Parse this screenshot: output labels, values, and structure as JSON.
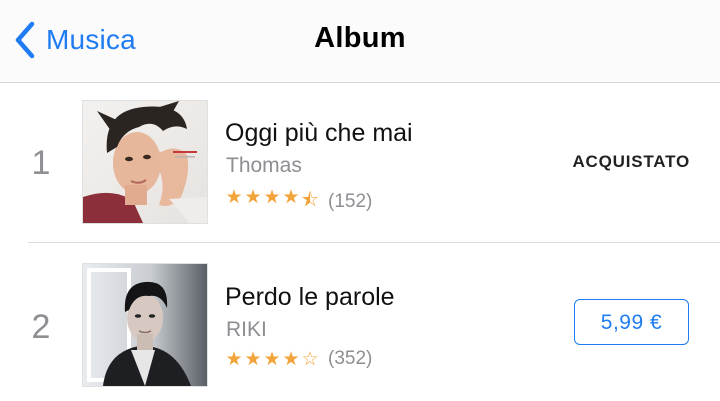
{
  "navbar": {
    "back_label": "Musica",
    "title": "Album"
  },
  "albums": [
    {
      "rank": "1",
      "title": "Oggi più che mai",
      "artist": "Thomas",
      "rating": 4.5,
      "stars": [
        "★",
        "★",
        "★",
        "★",
        "⯪"
      ],
      "rating_count": "(152)",
      "action": "ACQUISTATO",
      "cover_icon": "album-cover-thomas"
    },
    {
      "rank": "2",
      "title": "Perdo le parole",
      "artist": "RIKI",
      "rating": 4,
      "stars": [
        "★",
        "★",
        "★",
        "★",
        "☆"
      ],
      "rating_count": "(352)",
      "action": "5,99 €",
      "cover_icon": "album-cover-riki"
    }
  ],
  "colors": {
    "accent": "#1f7cf2",
    "star": "#f2a33a",
    "secondary_text": "#8e8e93"
  }
}
